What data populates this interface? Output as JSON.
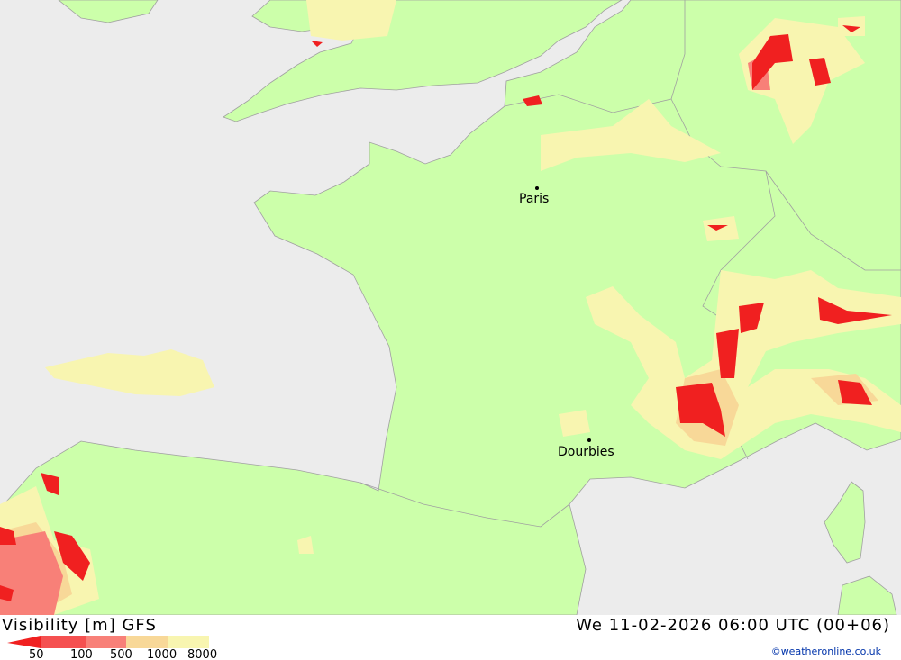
{
  "map": {
    "title": "Visibility [m] GFS",
    "datetime": "We 11-02-2026 06:00 UTC (00+06)",
    "copyright": "©weatheronline.co.uk",
    "cities": [
      {
        "name": "Paris"
      },
      {
        "name": "Dourbies"
      }
    ],
    "colors": {
      "sea": "#ececec",
      "land": "#ccffaa",
      "border": "#a0a0a0"
    },
    "legend": {
      "ticks": [
        "50",
        "100",
        "500",
        "1000",
        "8000"
      ],
      "colors": [
        "#f02020",
        "#f55050",
        "#f88078",
        "#f8d898",
        "#f8f5b0"
      ]
    }
  }
}
